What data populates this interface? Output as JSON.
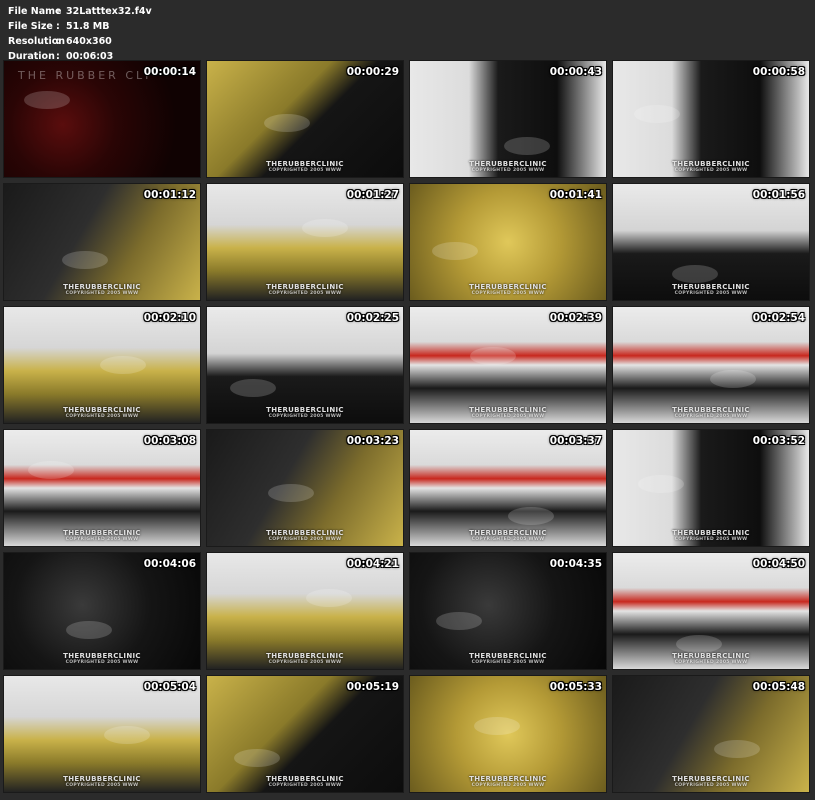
{
  "info": {
    "file_name_label": "File Name",
    "file_name": "32Latttex32.f4v",
    "file_size_label": "File Size",
    "file_size": "51.8 MB",
    "resolution_label": "Resolution",
    "resolution": "640x360",
    "duration_label": "Duration",
    "duration": "00:06:03",
    "separator": ":"
  },
  "watermark": {
    "brand": "THERUBBERCLINIC",
    "copyright": "COPYRIGHTED 2005 WWW"
  },
  "logo_text": "THE RUBBER CLI",
  "thumbnails": [
    {
      "time": "00:00:14",
      "scene": "logo-red"
    },
    {
      "time": "00:00:29",
      "scene": "yellow-black"
    },
    {
      "time": "00:00:43",
      "scene": "mask-white"
    },
    {
      "time": "00:00:58",
      "scene": "mask-white"
    },
    {
      "time": "00:01:12",
      "scene": "dark-yellow"
    },
    {
      "time": "00:01:27",
      "scene": "clinic-yellow"
    },
    {
      "time": "00:01:41",
      "scene": "yellow-close"
    },
    {
      "time": "00:01:56",
      "scene": "clinic-black"
    },
    {
      "time": "00:02:10",
      "scene": "clinic-yellow"
    },
    {
      "time": "00:02:25",
      "scene": "clinic-black"
    },
    {
      "time": "00:02:39",
      "scene": "clinic-red"
    },
    {
      "time": "00:02:54",
      "scene": "clinic-red"
    },
    {
      "time": "00:03:08",
      "scene": "clinic-red"
    },
    {
      "time": "00:03:23",
      "scene": "dark-yellow"
    },
    {
      "time": "00:03:37",
      "scene": "clinic-red"
    },
    {
      "time": "00:03:52",
      "scene": "mask-white"
    },
    {
      "time": "00:04:06",
      "scene": "dark-black"
    },
    {
      "time": "00:04:21",
      "scene": "clinic-yellow"
    },
    {
      "time": "00:04:35",
      "scene": "dark-black"
    },
    {
      "time": "00:04:50",
      "scene": "clinic-red"
    },
    {
      "time": "00:05:04",
      "scene": "clinic-yellow"
    },
    {
      "time": "00:05:19",
      "scene": "yellow-black"
    },
    {
      "time": "00:05:33",
      "scene": "yellow-close"
    },
    {
      "time": "00:05:48",
      "scene": "dark-yellow"
    }
  ],
  "colors": {
    "background": "#2b2b2b",
    "latex_yellow": "#c9b24a",
    "latex_black": "#121212",
    "clinic_white": "#e8e8e8",
    "clinic_red": "#c8281e"
  }
}
